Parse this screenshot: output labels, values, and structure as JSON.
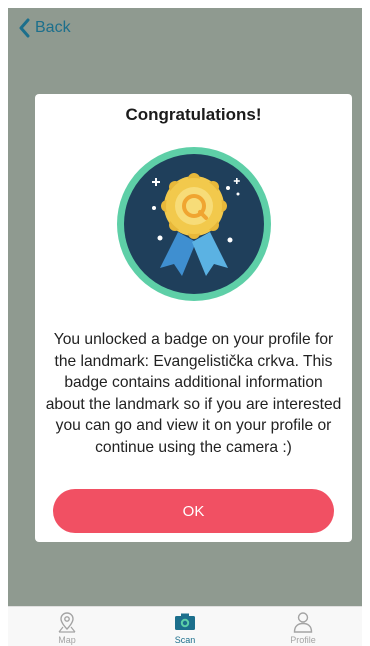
{
  "header": {
    "back_label": "Back"
  },
  "modal": {
    "title": "Congratulations!",
    "message": "You unlocked a badge on your profile for the landmark: Evangelistička crkva. This badge contains additional information about the landmark so if you are interested you can go and view it on your profile or continue using the camera :)",
    "ok_label": "OK",
    "badge_icon": "award-ribbon-icon"
  },
  "tabbar": {
    "tabs": [
      {
        "label": "Map",
        "icon": "map-pin-icon",
        "active": false
      },
      {
        "label": "Scan",
        "icon": "camera-icon",
        "active": true
      },
      {
        "label": "Profile",
        "icon": "user-icon",
        "active": false
      }
    ]
  },
  "colors": {
    "accent": "#1c6f8c",
    "ok_button": "#f15063",
    "overlay": "#8f9a90",
    "badge_ring": "#5ecfa7",
    "badge_bg": "#1f3f5b",
    "medal_gold": "#f2c94c",
    "ribbon_blue": "#5bb2e3"
  }
}
